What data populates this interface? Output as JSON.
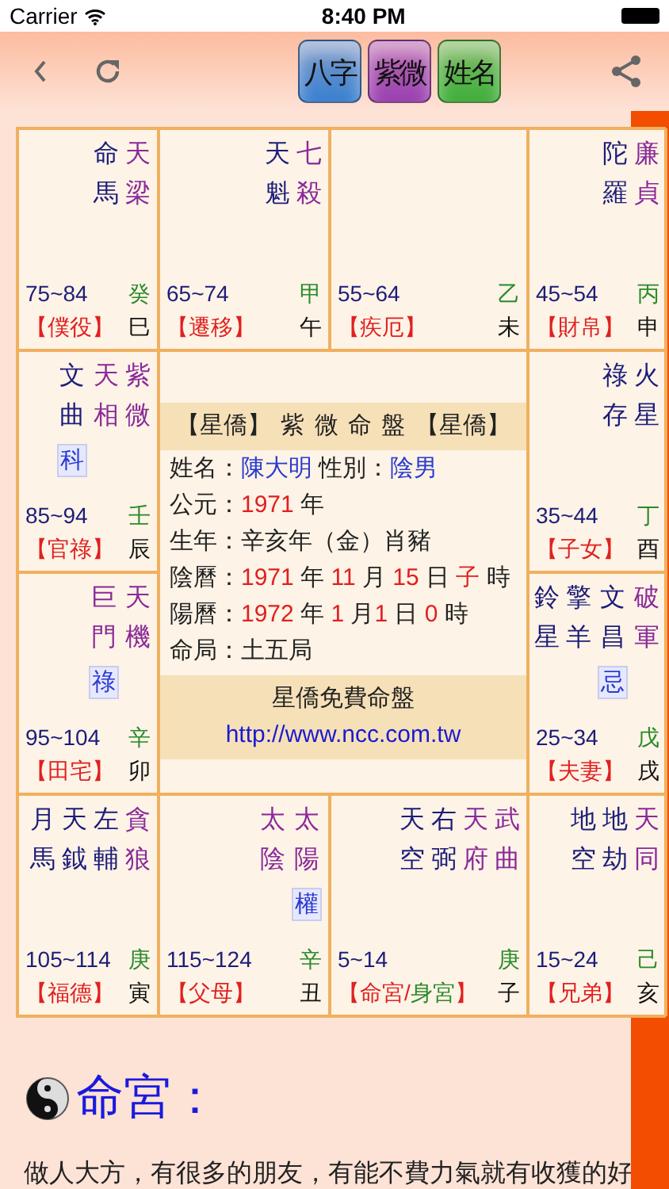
{
  "status_bar": {
    "carrier": "Carrier",
    "time": "8:40 PM"
  },
  "nav": {
    "apps": [
      {
        "label": "八字",
        "color": "#3a7fd0"
      },
      {
        "label": "紫微",
        "color": "#9a3fb0"
      },
      {
        "label": "姓名",
        "color": "#3fae3a"
      }
    ]
  },
  "chart": {
    "cells": [
      {
        "stars": [
          {
            "name": "命馬",
            "kind": "minor"
          },
          {
            "name": "天梁",
            "kind": "major"
          }
        ],
        "ages": "75~84",
        "stem": "癸",
        "palace": [
          {
            "text": "【僕役】",
            "kind": "palace"
          }
        ],
        "branch": "巳"
      },
      {
        "stars": [
          {
            "name": "天魁",
            "kind": "minor"
          },
          {
            "name": "七殺",
            "kind": "major"
          }
        ],
        "ages": "65~74",
        "stem": "甲",
        "palace": [
          {
            "text": "【遷移】",
            "kind": "palace"
          }
        ],
        "branch": "午"
      },
      {
        "ages": "55~64",
        "stem": "乙",
        "palace": [
          {
            "text": "【疾厄】",
            "kind": "palace"
          }
        ],
        "branch": "未"
      },
      {
        "stars": [
          {
            "name": "陀羅",
            "kind": "minor"
          },
          {
            "name": "廉貞",
            "kind": "major"
          }
        ],
        "ages": "45~54",
        "stem": "丙",
        "palace": [
          {
            "text": "【財帛】",
            "kind": "palace"
          }
        ],
        "branch": "申"
      },
      {
        "stars": [
          {
            "name": "文曲",
            "kind": "minor",
            "transform": "科"
          },
          {
            "name": "天相",
            "kind": "major"
          },
          {
            "name": "紫微",
            "kind": "major"
          }
        ],
        "ages": "85~94",
        "stem": "壬",
        "palace": [
          {
            "text": "【官祿】",
            "kind": "palace"
          }
        ],
        "branch": "辰"
      },
      {
        "stars": [
          {
            "name": "祿存",
            "kind": "minor"
          },
          {
            "name": "火星",
            "kind": "minor"
          }
        ],
        "ages": "35~44",
        "stem": "丁",
        "palace": [
          {
            "text": "【子女】",
            "kind": "palace"
          }
        ],
        "branch": "酉"
      },
      {
        "stars": [
          {
            "name": "巨門",
            "kind": "major",
            "transform": "祿"
          },
          {
            "name": "天機",
            "kind": "major"
          }
        ],
        "ages": "95~104",
        "stem": "辛",
        "palace": [
          {
            "text": "【田宅】",
            "kind": "palace"
          }
        ],
        "branch": "卯"
      },
      {
        "stars": [
          {
            "name": "鈴星",
            "kind": "minor"
          },
          {
            "name": "擎羊",
            "kind": "minor"
          },
          {
            "name": "文昌",
            "kind": "minor",
            "transform": "忌"
          },
          {
            "name": "破軍",
            "kind": "major"
          }
        ],
        "ages": "25~34",
        "stem": "戊",
        "palace": [
          {
            "text": "【夫妻】",
            "kind": "palace"
          }
        ],
        "branch": "戌"
      },
      {
        "stars": [
          {
            "name": "月馬",
            "kind": "minor"
          },
          {
            "name": "天鉞",
            "kind": "minor"
          },
          {
            "name": "左輔",
            "kind": "minor"
          },
          {
            "name": "貪狼",
            "kind": "major"
          }
        ],
        "ages": "105~114",
        "stem": "庚",
        "palace": [
          {
            "text": "【福德】",
            "kind": "palace"
          }
        ],
        "branch": "寅"
      },
      {
        "stars": [
          {
            "name": "太陰",
            "kind": "major"
          },
          {
            "name": "太陽",
            "kind": "major",
            "transform": "權"
          }
        ],
        "ages": "115~124",
        "stem": "辛",
        "palace": [
          {
            "text": "【父母】",
            "kind": "palace"
          }
        ],
        "branch": "丑"
      },
      {
        "stars": [
          {
            "name": "天空",
            "kind": "minor"
          },
          {
            "name": "右弼",
            "kind": "minor"
          },
          {
            "name": "天府",
            "kind": "major"
          },
          {
            "name": "武曲",
            "kind": "major"
          }
        ],
        "ages": "5~14",
        "stem": "庚",
        "palace": [
          {
            "text": "【命宮/",
            "kind": "palace"
          },
          {
            "text": "身宮",
            "kind": "body"
          },
          {
            "text": "】",
            "kind": "palace"
          }
        ],
        "branch": "子"
      },
      {
        "stars": [
          {
            "name": "地空",
            "kind": "minor"
          },
          {
            "name": "地劫",
            "kind": "minor"
          },
          {
            "name": "天同",
            "kind": "major"
          }
        ],
        "ages": "15~24",
        "stem": "己",
        "palace": [
          {
            "text": "【兄弟】",
            "kind": "palace"
          }
        ],
        "branch": "亥"
      }
    ],
    "center": {
      "title": "【星僑】 紫 微 命 盤 【星僑】",
      "lines": [
        [
          {
            "text": "姓名：",
            "kind": "label"
          },
          {
            "text": "陳大明",
            "kind": "value"
          },
          {
            "text": " 性別：",
            "kind": "label"
          },
          {
            "text": "陰男",
            "kind": "value"
          }
        ],
        [
          {
            "text": "公元：",
            "kind": "label"
          },
          {
            "text": "1971",
            "kind": "number"
          },
          {
            "text": " 年",
            "kind": "label"
          }
        ],
        [
          {
            "text": "生年：辛亥年（金）肖豬",
            "kind": "label"
          }
        ],
        [
          {
            "text": "陰曆：",
            "kind": "label"
          },
          {
            "text": "1971",
            "kind": "number"
          },
          {
            "text": " 年 ",
            "kind": "label"
          },
          {
            "text": "11",
            "kind": "number"
          },
          {
            "text": " 月 ",
            "kind": "label"
          },
          {
            "text": "15",
            "kind": "number"
          },
          {
            "text": " 日 ",
            "kind": "label"
          },
          {
            "text": "子",
            "kind": "number"
          },
          {
            "text": " 時",
            "kind": "label"
          }
        ],
        [
          {
            "text": "陽曆：",
            "kind": "label"
          },
          {
            "text": "1972",
            "kind": "number"
          },
          {
            "text": " 年 ",
            "kind": "label"
          },
          {
            "text": "1",
            "kind": "number"
          },
          {
            "text": " 月",
            "kind": "label"
          },
          {
            "text": "1",
            "kind": "number"
          },
          {
            "text": " 日 ",
            "kind": "label"
          },
          {
            "text": "0",
            "kind": "number"
          },
          {
            "text": " 時",
            "kind": "label"
          }
        ],
        [
          {
            "text": "命局：土五局",
            "kind": "label"
          }
        ]
      ],
      "footer": "星僑免費命盤",
      "link": "http://www.ncc.com.tw"
    }
  },
  "section": {
    "heading": "命宮：",
    "text": "做人大方，有很多的朋友，有能不費力氣就有收獲的好"
  }
}
